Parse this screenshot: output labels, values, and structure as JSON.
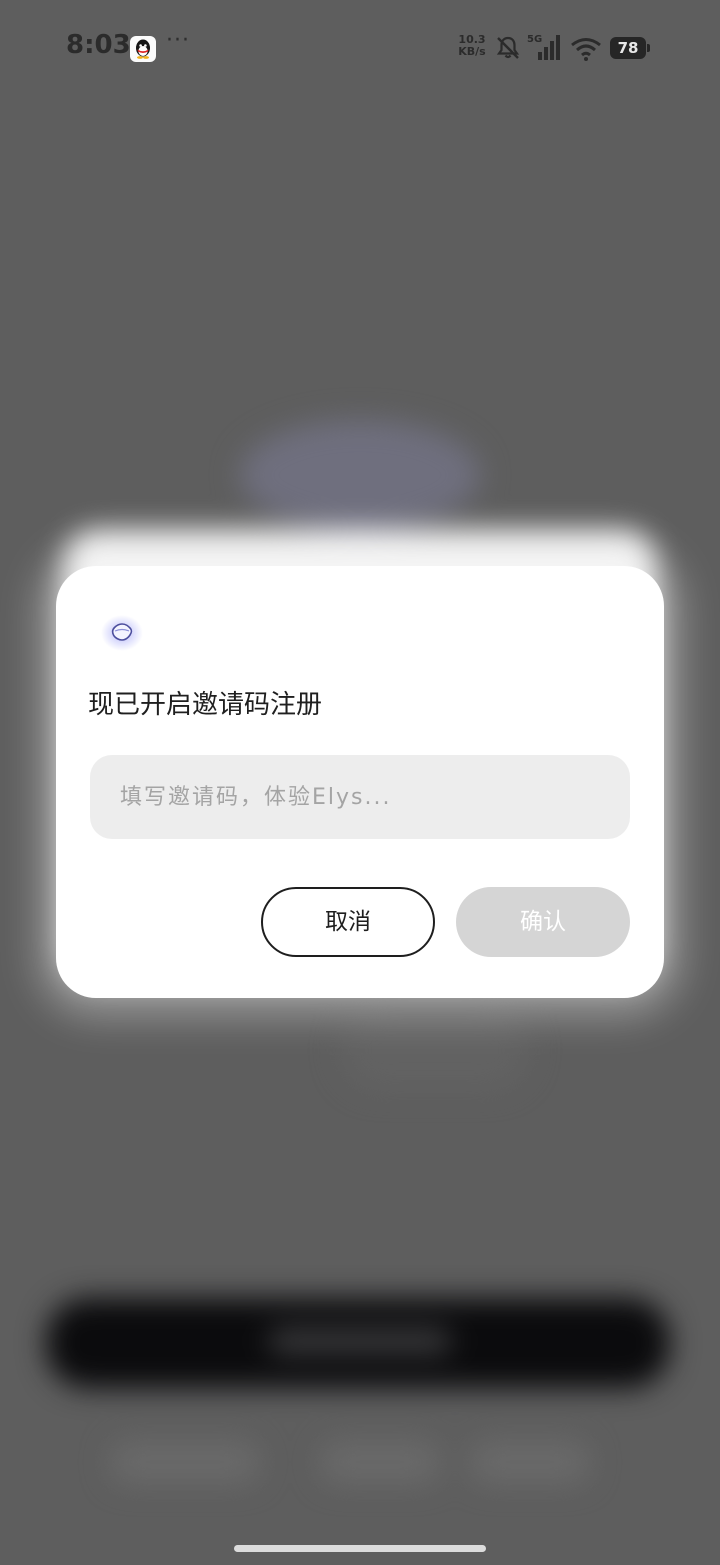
{
  "status_bar": {
    "time": "8:03",
    "more": "···",
    "net_speed_value": "10.3",
    "net_speed_unit": "KB/s",
    "network_type": "5G",
    "battery_level": "78",
    "icons": [
      "qq-icon",
      "bell-muted-icon",
      "signal-icon",
      "wifi-icon",
      "battery-icon"
    ]
  },
  "dialog": {
    "logo": "app-logo-icon",
    "title": "现已开启邀请码注册",
    "invite_placeholder": "填写邀请码，体验Elys...",
    "cancel_label": "取消",
    "confirm_label": "确认"
  },
  "colors": {
    "overlay": "#5e5e5e",
    "dialog_bg": "#ffffff",
    "input_bg": "#ededed",
    "confirm_disabled": "#d5d5d5",
    "logo_accent": "#7b7ff5"
  }
}
